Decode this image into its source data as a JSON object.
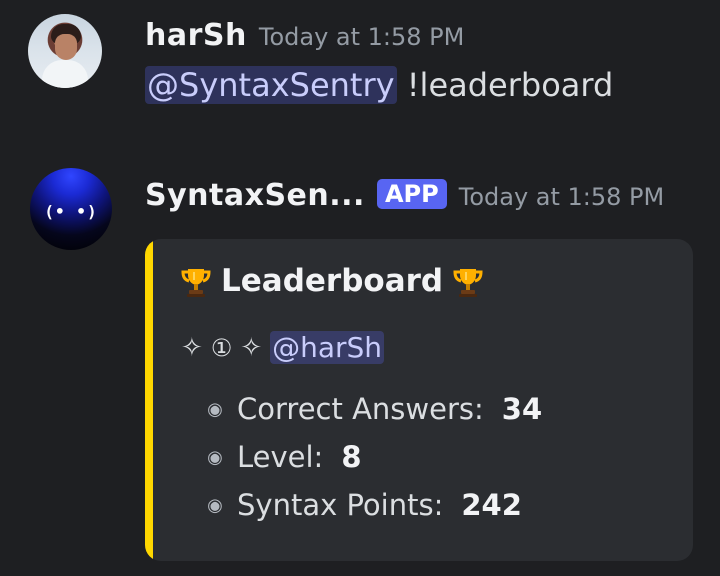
{
  "messages": [
    {
      "author": "harSh",
      "timestamp": "Today at 1:58 PM",
      "mention": "@SyntaxSentry",
      "text": "!leaderboard"
    },
    {
      "author": "SyntaxSen...",
      "badge": "APP",
      "timestamp": "Today at 1:58 PM",
      "embed": {
        "title": "Leaderboard",
        "accent_color": "#ffd700",
        "rank": "①",
        "sparkle_left": "✧",
        "sparkle_right": "✧",
        "mention": "@harSh",
        "stats": [
          {
            "label": "Correct Answers:",
            "value": "34"
          },
          {
            "label": "Level:",
            "value": "8"
          },
          {
            "label": "Syntax Points:",
            "value": "242"
          }
        ]
      }
    }
  ],
  "icons": {
    "user_avatar": "user-photo-avatar",
    "bot_avatar": "syntaxsentry-bot-avatar",
    "trophy": "trophy-icon",
    "bullet": "bullet-icon",
    "sparkle": "sparkle-icon"
  }
}
